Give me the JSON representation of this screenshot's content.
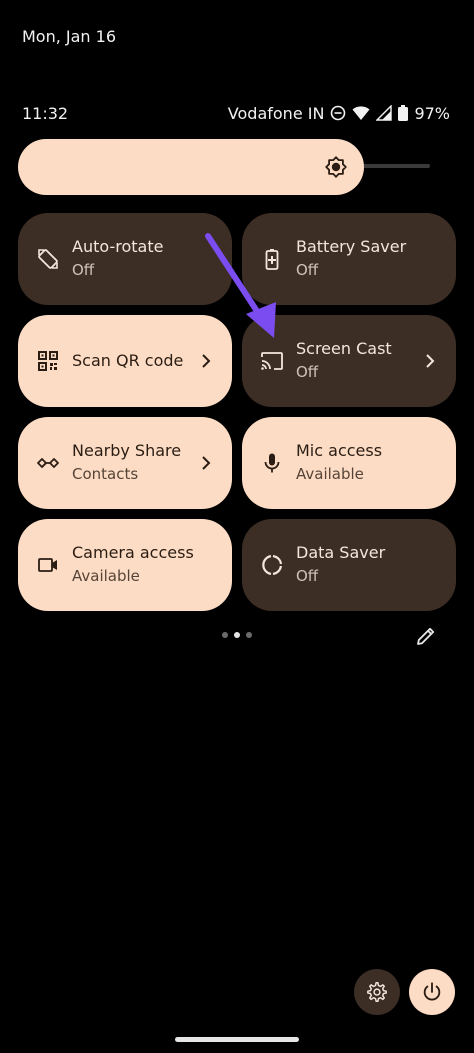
{
  "header": {
    "date": "Mon, Jan 16"
  },
  "status_bar": {
    "time": "11:32",
    "carrier": "Vodafone IN",
    "battery": "97%"
  },
  "brightness": {
    "level_percent": 83
  },
  "tiles": [
    {
      "label": "Auto-rotate",
      "sub": "Off",
      "state": "off",
      "icon": "rotate-icon"
    },
    {
      "label": "Battery Saver",
      "sub": "Off",
      "state": "off",
      "icon": "battery-saver-icon"
    },
    {
      "label": "Scan QR code",
      "sub": "",
      "state": "on",
      "icon": "qr-code-icon",
      "chevron": true
    },
    {
      "label": "Screen Cast",
      "sub": "Off",
      "state": "off",
      "icon": "cast-icon",
      "chevron": true
    },
    {
      "label": "Nearby Share",
      "sub": "Contacts",
      "state": "on",
      "icon": "nearby-share-icon",
      "chevron": true
    },
    {
      "label": "Mic access",
      "sub": "Available",
      "state": "on",
      "icon": "mic-icon"
    },
    {
      "label": "Camera access",
      "sub": "Available",
      "state": "on",
      "icon": "camera-icon"
    },
    {
      "label": "Data Saver",
      "sub": "Off",
      "state": "off",
      "icon": "data-saver-icon"
    }
  ],
  "pager": {
    "pages": 3,
    "active": 1
  },
  "colors": {
    "tile_on": "#fcdcc4",
    "tile_off": "#3c2e25",
    "annotation_arrow": "#7b4df0"
  }
}
